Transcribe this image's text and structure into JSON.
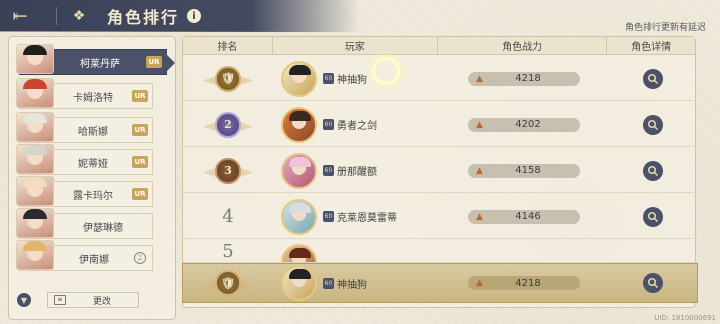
{
  "header": {
    "back_icon": "back-arrow-icon",
    "home_icon": "home-grid-icon",
    "title": "角色排行",
    "info_icon": "i"
  },
  "notice": "角色排行更新有延迟",
  "sidebar": {
    "items": [
      {
        "name": "柯莱丹萨",
        "badge": "UR",
        "selected": true
      },
      {
        "name": "卡姆洛特",
        "badge": "UR",
        "selected": false
      },
      {
        "name": "哈斯娜",
        "badge": "UR",
        "selected": false
      },
      {
        "name": "妮蒂娅",
        "badge": "UR",
        "selected": false
      },
      {
        "name": "露卡玛尔",
        "badge": "UR",
        "selected": false
      },
      {
        "name": "伊瑟琳德",
        "badge": "",
        "selected": false
      },
      {
        "name": "伊南娜",
        "badge": "2",
        "selected": false
      }
    ],
    "change_label": "更改",
    "change_icon": "sort-icon"
  },
  "table": {
    "headers": [
      "排名",
      "玩家",
      "角色战力",
      "角色详情"
    ],
    "rows": [
      {
        "rank": "1",
        "medal": "gold",
        "level": "60",
        "player": "神抽狗",
        "power": "4218"
      },
      {
        "rank": "2",
        "medal": "purple",
        "level": "60",
        "player": "勇者之剑",
        "power": "4202"
      },
      {
        "rank": "3",
        "medal": "bronze",
        "level": "60",
        "player": "册那醒额",
        "power": "4158"
      },
      {
        "rank": "4",
        "medal": "",
        "level": "60",
        "player": "克莱恩莫雷蒂",
        "power": "4146"
      },
      {
        "rank": "5",
        "medal": "",
        "level": "",
        "player": "",
        "power": ""
      }
    ],
    "self_row": {
      "rank": "1",
      "medal": "gold",
      "level": "60",
      "player": "神抽狗",
      "power": "4218"
    }
  },
  "uid": "UID: 1810000691",
  "colors": {
    "header_bg": "#3a4156",
    "accent_gold": "#c9a55a",
    "button_dark": "#4b5169",
    "page_bg": "#efe9db"
  }
}
